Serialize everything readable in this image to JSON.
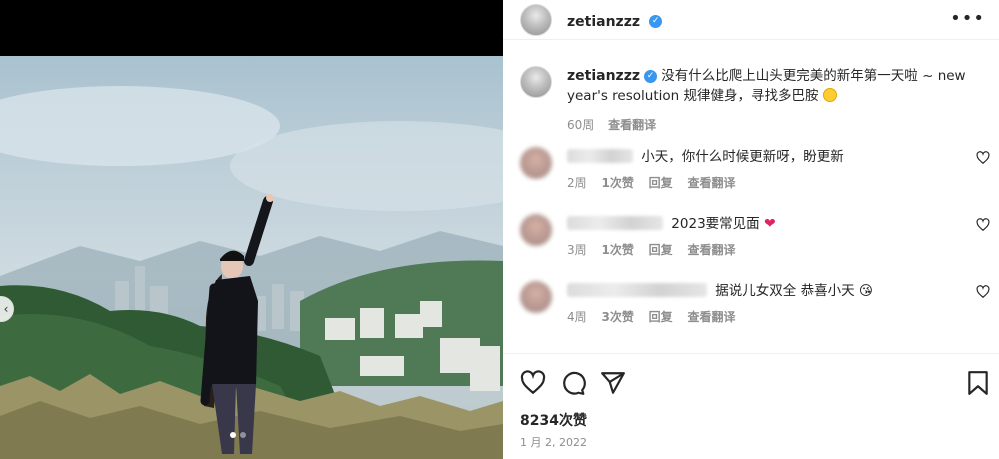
{
  "post": {
    "username": "zetianzzz",
    "more_label": "•••",
    "caption": {
      "username": "zetianzzz",
      "text": "没有什么比爬上山头更完美的新年第一天啦 ~ new year's resolution 规律健身，寻找多巴胺",
      "age": "60周",
      "translate": "查看翻译"
    },
    "comments": [
      {
        "text": "小天，你什么时候更新呀，盼更新",
        "age": "2周",
        "likes": "1次赞",
        "reply": "回复",
        "translate": "查看翻译",
        "emoji": ""
      },
      {
        "text": "2023要常见面",
        "age": "3周",
        "likes": "1次赞",
        "reply": "回复",
        "translate": "查看翻译",
        "emoji": "❤"
      },
      {
        "text": "据说儿女双全 恭喜小天",
        "age": "4周",
        "likes": "3次赞",
        "reply": "回复",
        "translate": "查看翻译",
        "emoji": "😘"
      }
    ],
    "likes_count": "8234次赞",
    "date": "1 月 2, 2022"
  },
  "icons": {
    "like": "heart-icon",
    "comment": "comment-icon",
    "share": "share-icon",
    "save": "bookmark-icon",
    "verified": "verified-badge-icon"
  },
  "colors": {
    "verified": "#3897f0",
    "heart": "#e0245e",
    "meta_text": "#8e8e8e"
  }
}
